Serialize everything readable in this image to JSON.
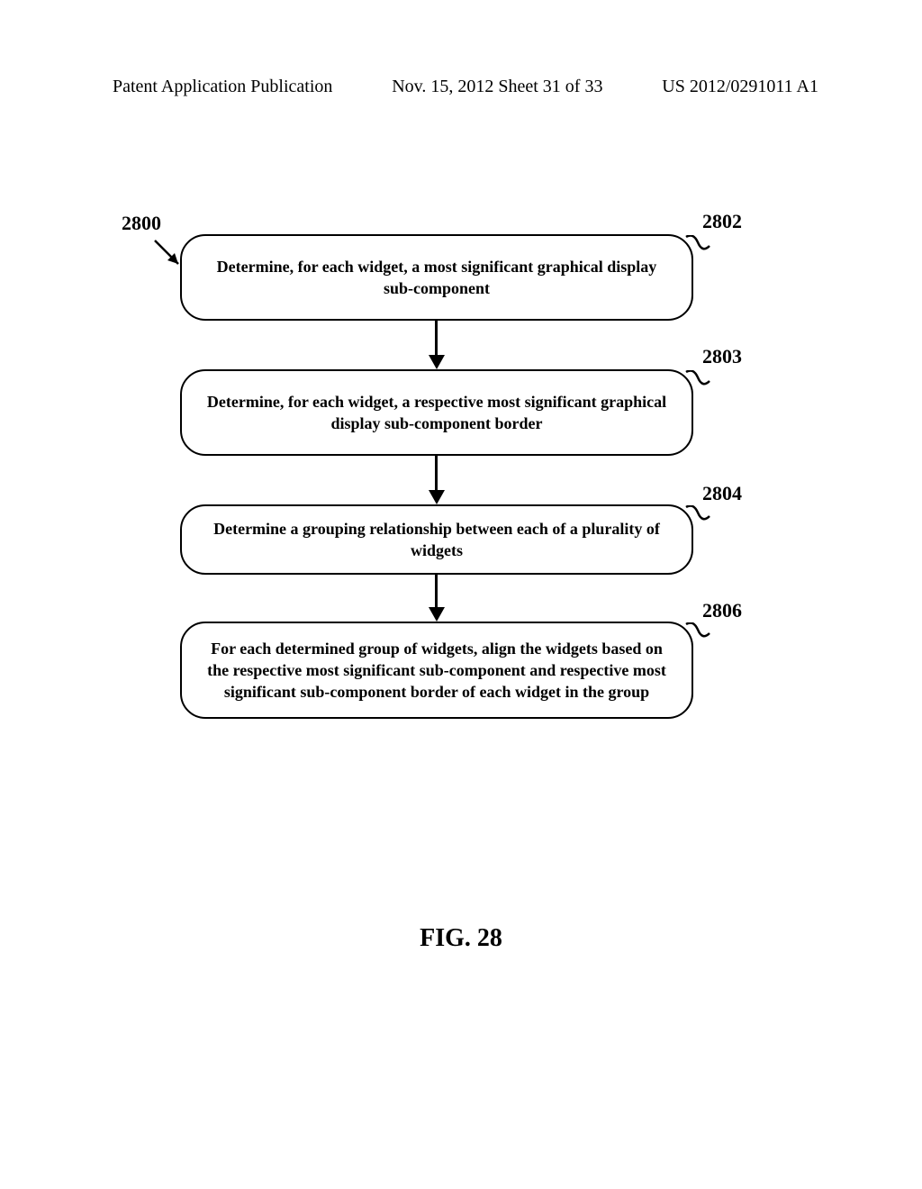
{
  "header": {
    "left": "Patent Application Publication",
    "center": "Nov. 15, 2012  Sheet 31 of 33",
    "right": "US 2012/0291011 A1"
  },
  "refs": {
    "r2800": "2800",
    "r2802": "2802",
    "r2803": "2803",
    "r2804": "2804",
    "r2806": "2806"
  },
  "boxes": {
    "b2802": "Determine, for each widget, a most significant graphical display sub-component",
    "b2803": "Determine, for each widget, a respective most significant graphical display sub-component border",
    "b2804": "Determine a grouping relationship between each of a plurality of widgets",
    "b2806": "For each determined group of widgets, align the widgets based on the respective most significant sub-component and respective most significant sub-component border of each widget in the group"
  },
  "figure": "FIG. 28"
}
